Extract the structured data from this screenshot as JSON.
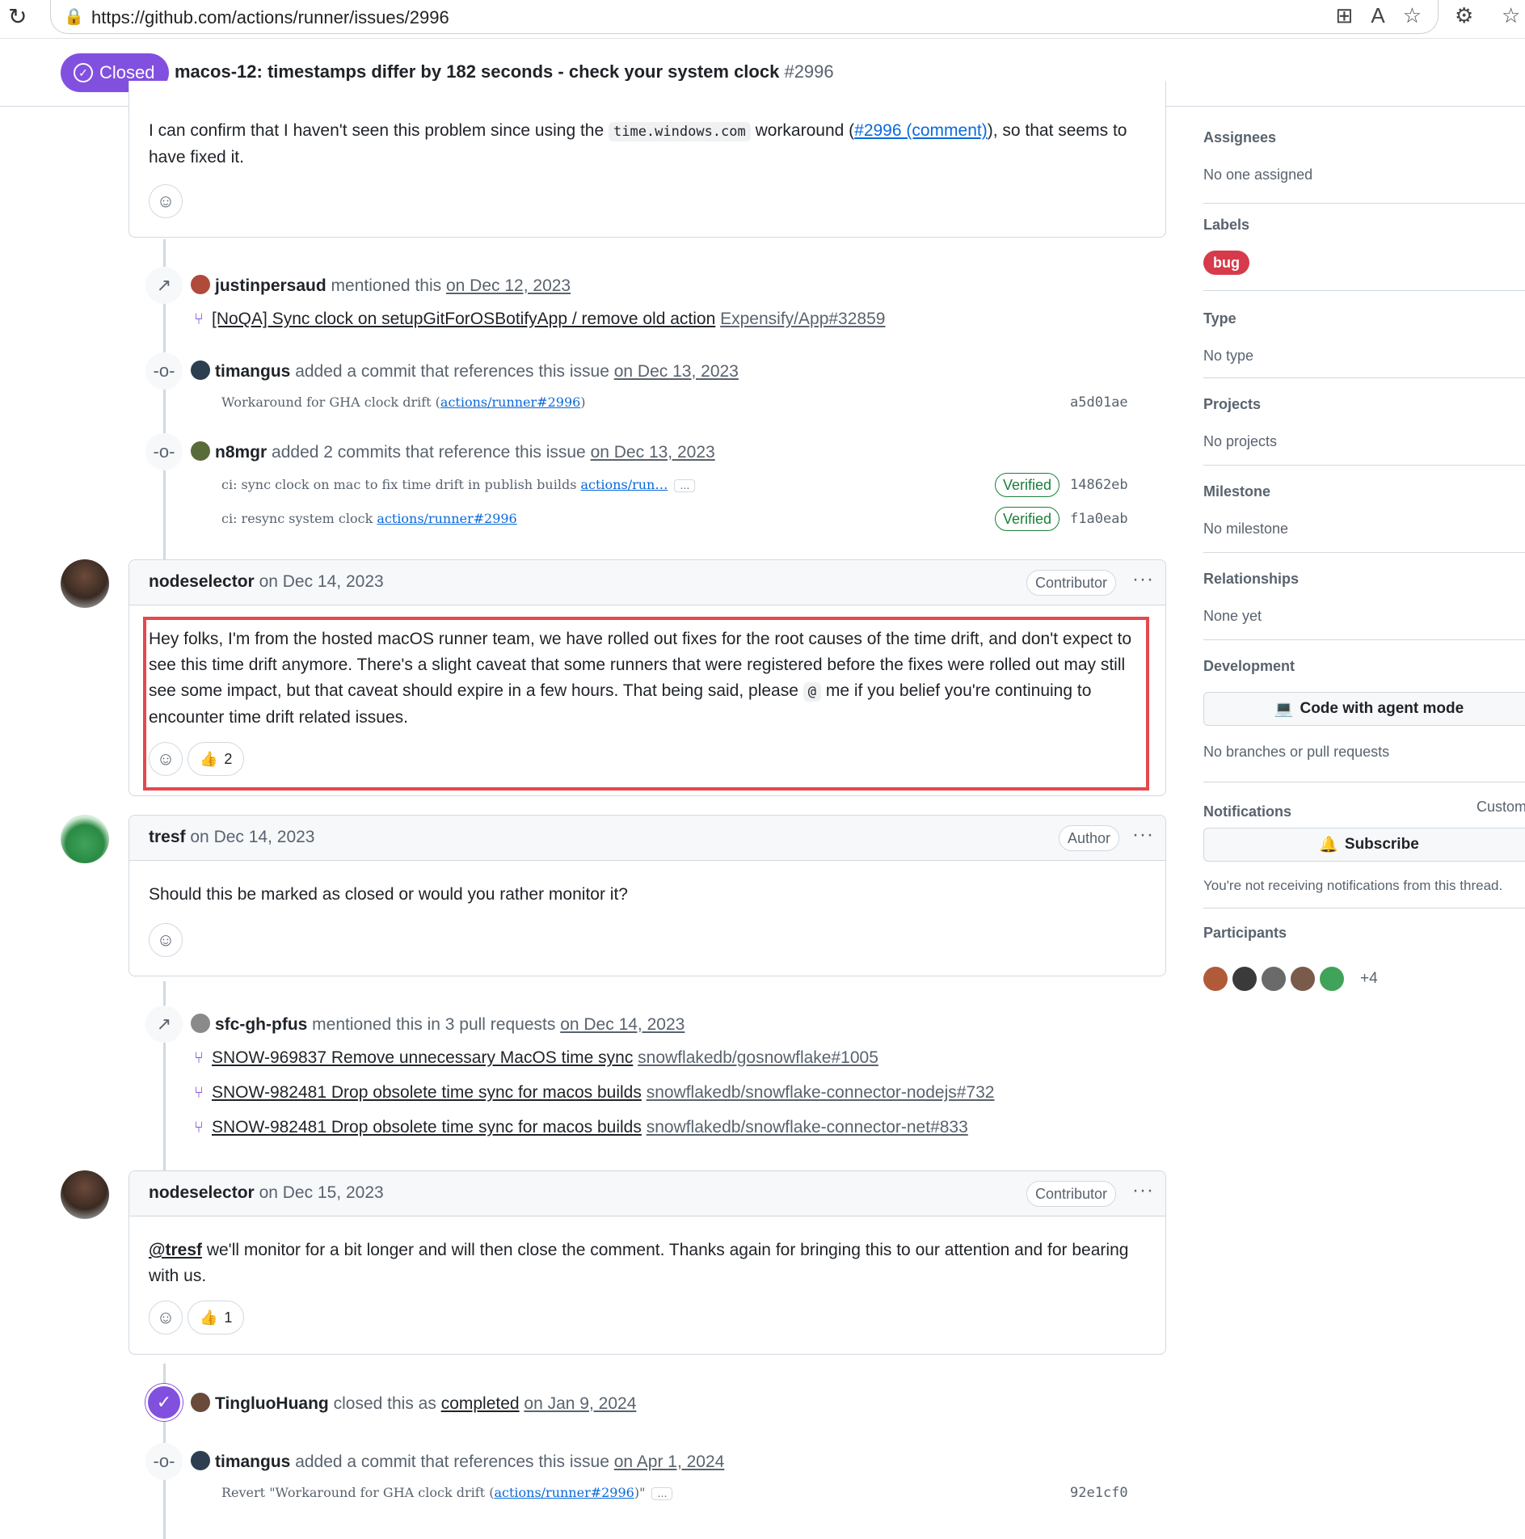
{
  "browser": {
    "url": "https://github.com/actions/runner/issues/2996"
  },
  "issue": {
    "state": "Closed",
    "title": "macos-12: timestamps differ by 182 seconds - check your system clock",
    "number": "#2996"
  },
  "comment0": {
    "text_before": "I can confirm that I haven't seen this problem since using the ",
    "code": "time.windows.com",
    "text_mid": " workaround (",
    "link": "#2996 (comment)",
    "text_after": "), so that seems to have fixed it."
  },
  "event_mention1": {
    "user": "justinpersaud",
    "action": "mentioned this",
    "date": "on Dec 12, 2023",
    "ref_title": "[NoQA] Sync clock on setupGitForOSBotifyApp / remove old action",
    "ref_repo": "Expensify/App#32859"
  },
  "event_commit1": {
    "user": "timangus",
    "action": "added a commit that references this issue",
    "date": "on Dec 13, 2023",
    "message": "Workaround for GHA clock drift (",
    "message_link": "actions/runner#2996",
    "message_end": ")",
    "sha": "a5d01ae"
  },
  "event_commit2": {
    "user": "n8mgr",
    "action": "added 2 commits that reference this issue",
    "date": "on Dec 13, 2023",
    "commits": [
      {
        "message": "ci: sync clock on mac to fix time drift in publish builds ",
        "link": "actions/run…",
        "badge": "Verified",
        "sha": "14862eb"
      },
      {
        "message": "ci: resync system clock ",
        "link": "actions/runner#2996",
        "badge": "Verified",
        "sha": "f1a0eab"
      }
    ]
  },
  "comment1": {
    "author": "nodeselector",
    "date": "on Dec 14, 2023",
    "role": "Contributor",
    "body_1": "Hey folks, I'm from the hosted macOS runner team, we have rolled out fixes for the root causes of the time drift, and don't expect to see this time drift anymore. There's a slight caveat that some runners that were registered before the fixes were rolled out may still see some impact, but that caveat should expire in a few hours. That being said, please ",
    "code": "@",
    "body_2": " me if you belief you're continuing to encounter time drift related issues.",
    "reaction_emoji": "👍",
    "reaction_count": "2"
  },
  "comment2": {
    "author": "tresf",
    "date": "on Dec 14, 2023",
    "role": "Author",
    "body": "Should this be marked as closed or would you rather monitor it?"
  },
  "event_mention2": {
    "user": "sfc-gh-pfus",
    "action": "mentioned this in 3 pull requests",
    "date": "on Dec 14, 2023",
    "refs": [
      {
        "title": "SNOW-969837 Remove unnecessary MacOS time sync",
        "repo": "snowflakedb/gosnowflake#1005"
      },
      {
        "title": "SNOW-982481 Drop obsolete time sync for macos builds",
        "repo": "snowflakedb/snowflake-connector-nodejs#732"
      },
      {
        "title": "SNOW-982481 Drop obsolete time sync for macos builds",
        "repo": "snowflakedb/snowflake-connector-net#833"
      }
    ]
  },
  "comment3": {
    "author": "nodeselector",
    "date": "on Dec 15, 2023",
    "role": "Contributor",
    "mention": "@tresf",
    "body": " we'll monitor for a bit longer and will then close the comment. Thanks again for bringing this to our attention and for bearing with us.",
    "reaction_emoji": "👍",
    "reaction_count": "1"
  },
  "event_closed": {
    "user": "TingluoHuang",
    "action": "closed this as",
    "reason": "completed",
    "date": "on Jan 9, 2024"
  },
  "event_commit3": {
    "user": "timangus",
    "action": "added a commit that references this issue",
    "date": "on Apr 1, 2024",
    "message": "Revert \"Workaround for GHA clock drift (",
    "message_link": "actions/runner#2996",
    "message_end": ")\"",
    "sha": "92e1cf0"
  },
  "sidebar": {
    "assignees_title": "Assignees",
    "assignees_value": "No one assigned",
    "labels_title": "Labels",
    "label_bug": "bug",
    "type_title": "Type",
    "type_value": "No type",
    "projects_title": "Projects",
    "projects_value": "No projects",
    "milestone_title": "Milestone",
    "milestone_value": "No milestone",
    "relationships_title": "Relationships",
    "relationships_value": "None yet",
    "development_title": "Development",
    "development_button": "Code with agent mode",
    "development_value": "No branches or pull requests",
    "notifications_title": "Notifications",
    "notifications_custom": "Custom",
    "subscribe_button": "Subscribe",
    "notifications_value": "You're not receiving notifications from this thread.",
    "participants_title": "Participants",
    "participants_more": "+4"
  },
  "colors": {
    "closed_purple": "#8250df",
    "verified_green": "#1a7f37",
    "bug_red": "#d73a4a",
    "highlight_red": "#e5484d",
    "link_blue": "#0969da"
  }
}
